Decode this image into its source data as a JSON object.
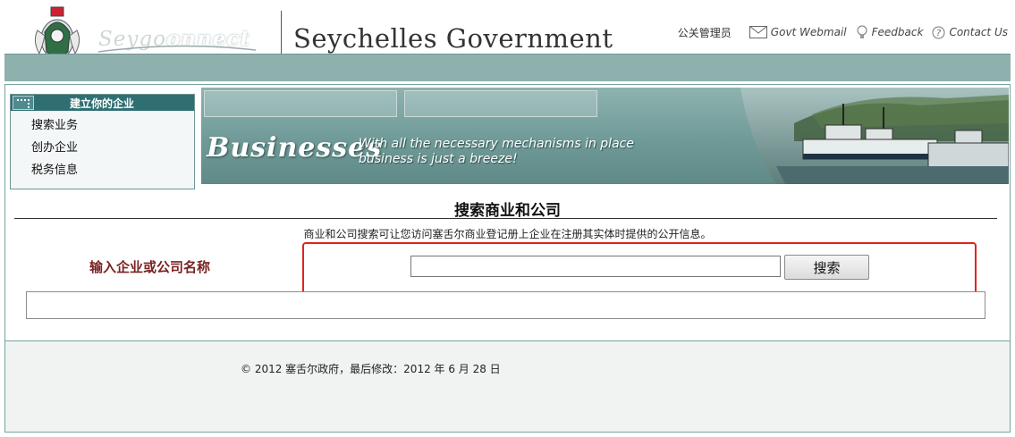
{
  "header": {
    "logo_text_light": "Seygo",
    "logo_text_bold": "onnect",
    "gov_title": "Seychelles Government",
    "admin_label": "公关管理员",
    "links": [
      {
        "label": "Govt Webmail",
        "icon": "envelope-icon"
      },
      {
        "label": "Feedback",
        "icon": "lightbulb-icon"
      },
      {
        "label": "Contact Us",
        "icon": "help-icon"
      }
    ]
  },
  "sidebar": {
    "title": "建立你的企业",
    "items": [
      "搜索业务",
      "创办企业",
      "税务信息"
    ]
  },
  "banner": {
    "heading": "Businesses",
    "tagline_line1": "With all the necessary mechanisms in place",
    "tagline_line2": "business is just a breeze!"
  },
  "main": {
    "title": "搜索商业和公司",
    "description": "商业和公司搜索可让您访问塞舌尔商业登记册上企业在注册其实体时提供的公开信息。",
    "field_label": "输入企业或公司名称",
    "input_value": "",
    "search_button": "搜索"
  },
  "footer": {
    "text": "© 2012 塞舌尔政府，最后修改：2012 年 6 月 28 日"
  },
  "colors": {
    "teal_bar": "#8fb1ae",
    "sidebar_header": "#2f6f73",
    "label_red": "#7a2222",
    "highlight": "#e0251b"
  }
}
